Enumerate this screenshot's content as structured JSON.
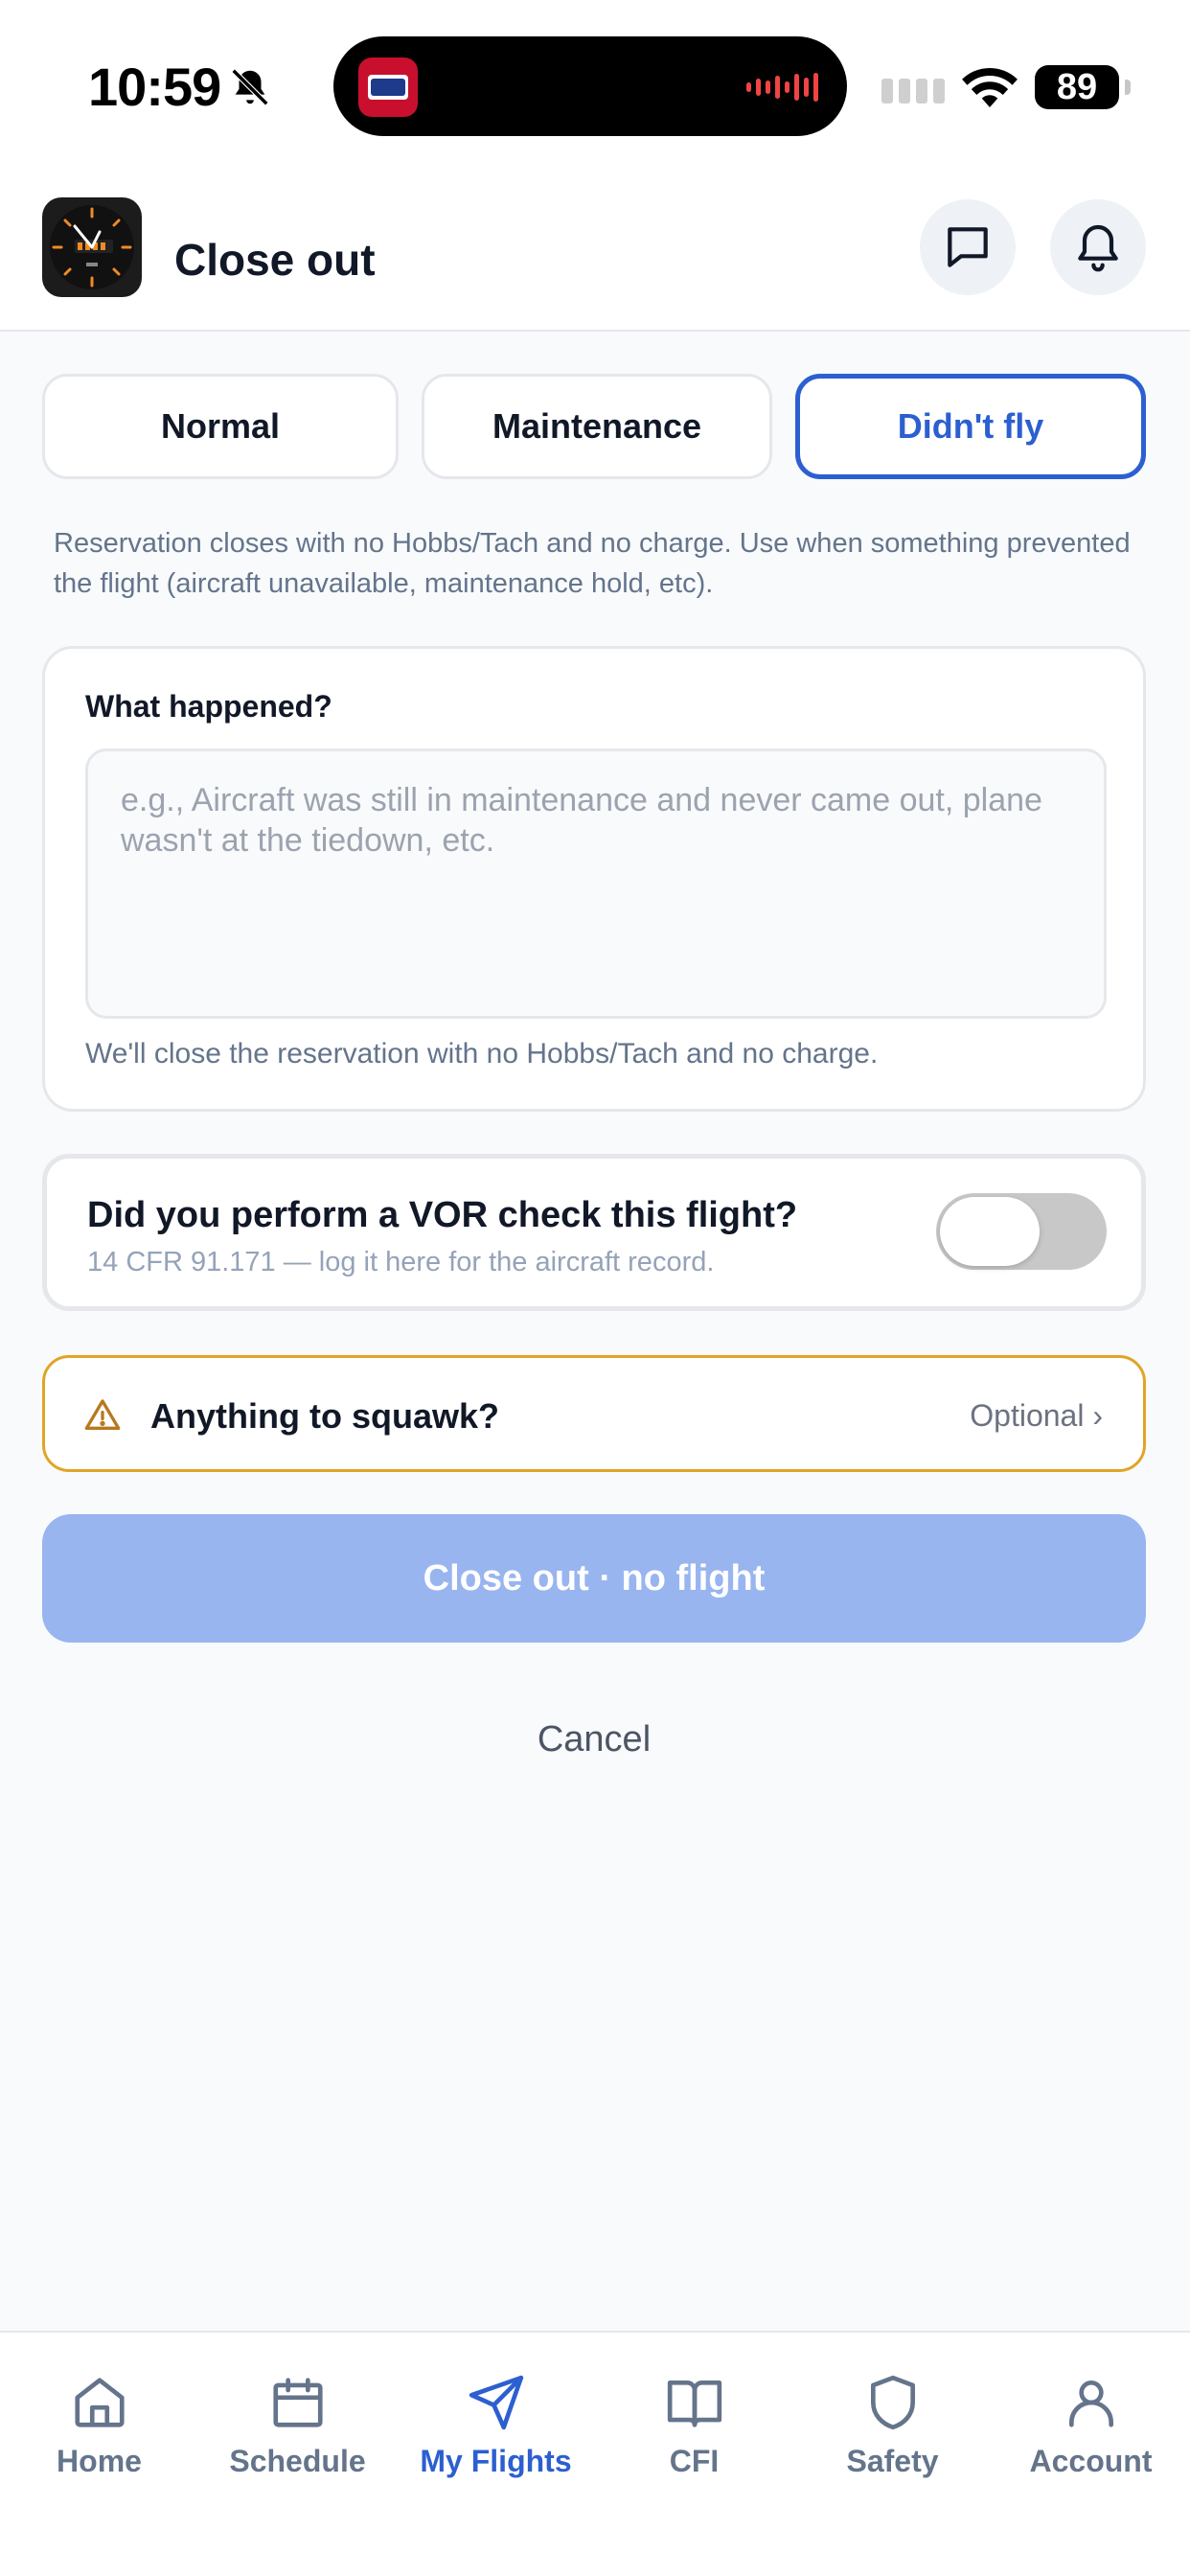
{
  "status_bar": {
    "time": "10:59",
    "battery": "89"
  },
  "header": {
    "title": "Close out",
    "icons": [
      "clock-logo-icon",
      "chat-icon",
      "bell-icon"
    ]
  },
  "modes": {
    "normal": "Normal",
    "maintenance": "Maintenance",
    "didnt_fly": "Didn't fly",
    "selected": "didnt_fly"
  },
  "description": "Reservation closes with no Hobbs/Tach and no charge. Use when something prevented the flight (aircraft unavailable, maintenance hold, etc).",
  "what_happened": {
    "label": "What happened?",
    "value": "",
    "placeholder": "e.g., Aircraft was still in maintenance and never came out, plane wasn't at the tiedown, etc.",
    "help": "We'll close the reservation with no Hobbs/Tach and no charge."
  },
  "vor": {
    "title": "Did you perform a VOR check this flight?",
    "subtitle": "14 CFR 91.171 — log it here for the aircraft record.",
    "enabled": false
  },
  "squawk": {
    "label": "Anything to squawk?",
    "optional": "Optional ›"
  },
  "actions": {
    "primary": "Close out · no flight",
    "cancel": "Cancel"
  },
  "tabs": [
    {
      "label": "Home",
      "icon": "home-icon"
    },
    {
      "label": "Schedule",
      "icon": "calendar-icon"
    },
    {
      "label": "My Flights",
      "icon": "paper-plane-icon",
      "active": true
    },
    {
      "label": "CFI",
      "icon": "book-icon"
    },
    {
      "label": "Safety",
      "icon": "shield-icon"
    },
    {
      "label": "Account",
      "icon": "user-icon"
    }
  ],
  "colors": {
    "accent": "#2c5fd0",
    "accent_disabled": "#99b5f0",
    "warning": "#e0a526",
    "background": "#f8fafc"
  }
}
